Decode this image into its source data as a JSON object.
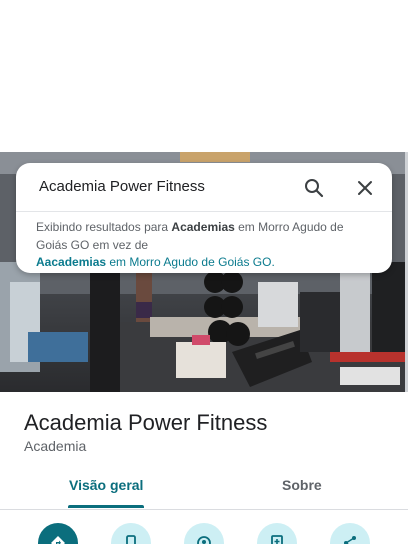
{
  "search": {
    "query": "Academia Power Fitness",
    "suggestion_prefix": "Exibindo resultados para ",
    "suggestion_term": "Academias",
    "suggestion_middle": " em Morro Agudo de Goiás GO em vez de",
    "original_term": "Aacademias",
    "original_suffix": " em Morro Agudo de Goiás GO."
  },
  "place": {
    "name": "Academia Power Fitness",
    "category": "Academia"
  },
  "tabs": [
    {
      "label": "Visão geral",
      "active": true
    },
    {
      "label": "Sobre",
      "active": false
    }
  ],
  "actions": [
    {
      "icon": "directions-icon"
    },
    {
      "icon": "phone-icon"
    },
    {
      "icon": "location-icon"
    },
    {
      "icon": "save-icon"
    },
    {
      "icon": "share-icon"
    }
  ],
  "colors": {
    "accent": "#0b6e7d",
    "link": "#0b7b8e",
    "action_bg": "#cdeff4"
  }
}
